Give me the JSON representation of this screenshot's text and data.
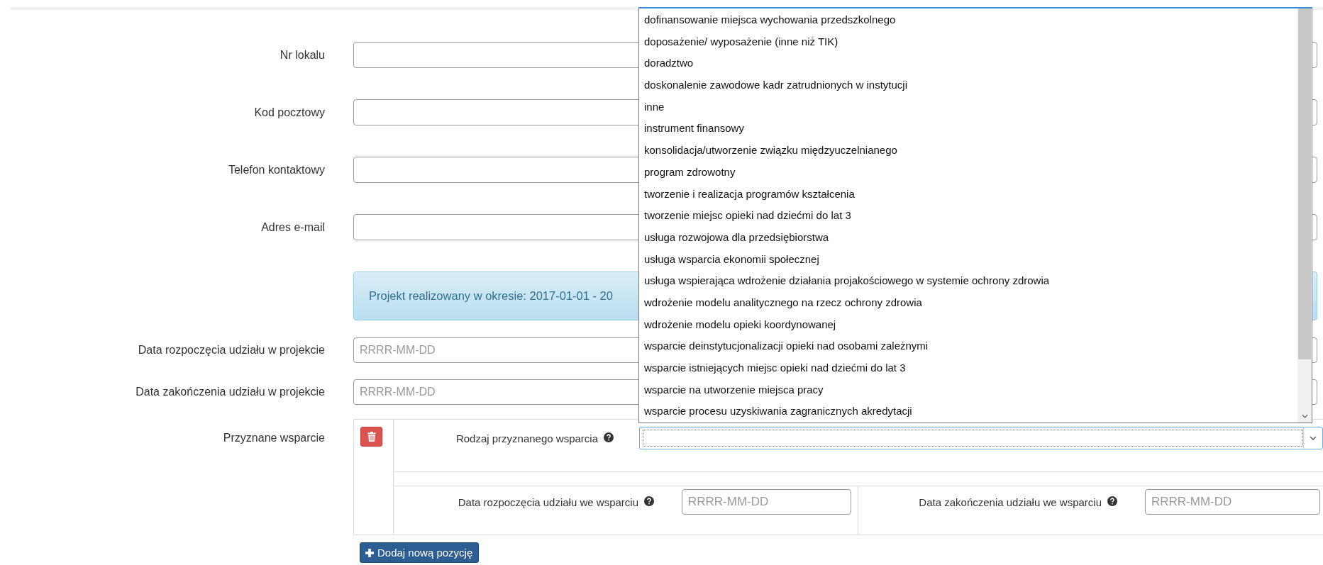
{
  "contact_fields": [
    {
      "label": "Nr lokalu"
    },
    {
      "label": "Kod pocztowy"
    },
    {
      "label": "Telefon kontaktowy"
    },
    {
      "label": "Adres e-mail"
    }
  ],
  "project_info": "Projekt realizowany w okresie: 2017-01-01 - 20",
  "date_fields": [
    {
      "label": "Data rozpoczęcia udziału w projekcie",
      "placeholder": "RRRR-MM-DD"
    },
    {
      "label": "Data zakończenia udziału w projekcie",
      "placeholder": "RRRR-MM-DD"
    }
  ],
  "support": {
    "label": "Przyznane wsparcie",
    "type_label": "Rodzaj przyznanego wsparcia",
    "start_label": "Data rozpoczęcia udziału we wsparciu",
    "start_placeholder": "RRRR-MM-DD",
    "end_label": "Data zakończenia udziału we wsparciu",
    "end_placeholder": "RRRR-MM-DD",
    "add_button": "Dodaj nową pozycję"
  },
  "dropdown": {
    "options": [
      {
        "label": "dofinansowanie miejsca wychowania przedszkolnego",
        "selected": false
      },
      {
        "label": "doposażenie/ wyposażenie (inne niż TIK)",
        "selected": false
      },
      {
        "label": "doradztwo",
        "selected": false
      },
      {
        "label": "doskonalenie zawodowe kadr zatrudnionych w instytucji",
        "selected": false
      },
      {
        "label": "inne",
        "selected": false
      },
      {
        "label": "instrument finansowy",
        "selected": false
      },
      {
        "label": "konsolidacja/utworzenie związku międzyuczelnianego",
        "selected": false
      },
      {
        "label": "program zdrowotny",
        "selected": false
      },
      {
        "label": "tworzenie i realizacja programów kształcenia",
        "selected": false
      },
      {
        "label": "tworzenie miejsc opieki nad dziećmi do lat 3",
        "selected": false
      },
      {
        "label": "usługa rozwojowa dla przedsiębiorstwa",
        "selected": false
      },
      {
        "label": "usługa wsparcia ekonomii społecznej",
        "selected": false
      },
      {
        "label": "usługa wspierająca wdrożenie działania projakościowego w systemie ochrony zdrowia",
        "selected": false
      },
      {
        "label": "wdrożenie modelu analitycznego na rzecz ochrony zdrowia",
        "selected": false
      },
      {
        "label": "wdrożenie modelu opieki koordynowanej",
        "selected": false
      },
      {
        "label": "wsparcie deinstytucjonalizacji opieki nad osobami zależnymi",
        "selected": false
      },
      {
        "label": "wsparcie istniejących miejsc opieki nad dziećmi do lat 3",
        "selected": false
      },
      {
        "label": "wsparcie na utworzenie miejsca pracy",
        "selected": false
      },
      {
        "label": "wsparcie procesu uzyskiwania zagranicznych akredytacji",
        "selected": false
      }
    ]
  }
}
